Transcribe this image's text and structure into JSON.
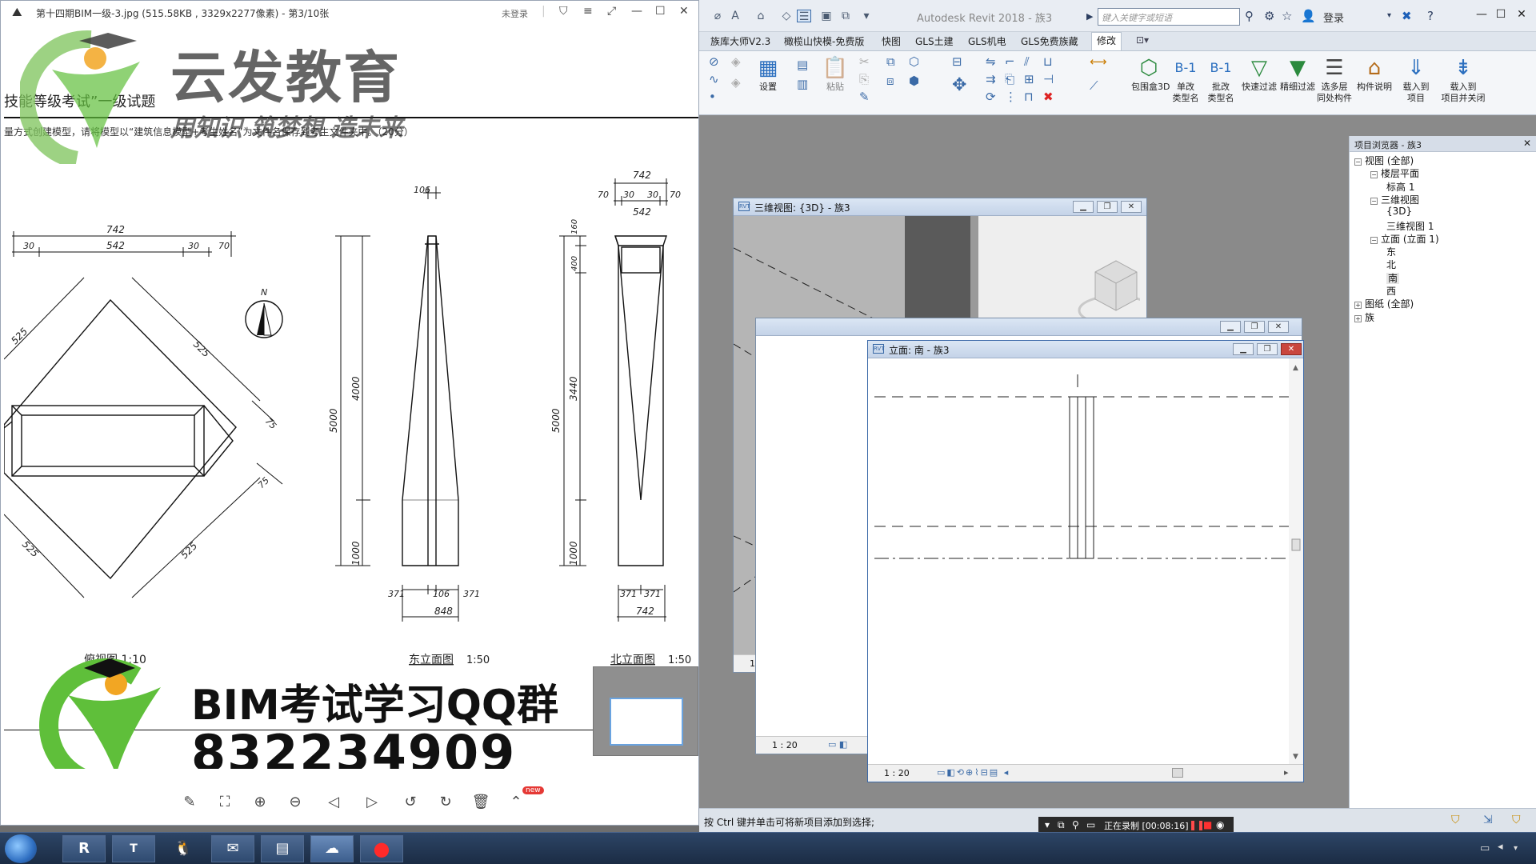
{
  "viewer": {
    "title": "第十四期BIM一级-3.jpg (515.58KB , 3329x2277像素) - 第3/10张",
    "login": "未登录"
  },
  "drawing": {
    "heading": "技能等级考试”一级试题",
    "instruction": "量方式创建模型，请将模型以“建筑信息模型+考生姓名”为文件名保存到考生文件夹中。（20分）",
    "compass_label": "N",
    "plan": {
      "dim_top": "742",
      "dim_left": "30",
      "dim_mid": "542",
      "dim_right1": "30",
      "dim_right2": "70",
      "edge_labels": [
        "525",
        "525",
        "525",
        "525"
      ],
      "offsets": [
        "75",
        "75"
      ],
      "caption": "俯视图  1:10"
    },
    "east": {
      "top_dim": "106",
      "total_height": "5000",
      "upper_height": "4000",
      "base_height": "1000",
      "bottom_dims": [
        "371",
        "106",
        "371"
      ],
      "bottom_total": "848",
      "caption": "东立面图",
      "scale": "1:50"
    },
    "north": {
      "top_total": "742",
      "top_parts": [
        "70",
        "30",
        "30",
        "70"
      ],
      "top_inner": "542",
      "top_heights": [
        "160",
        "400"
      ],
      "total_height": "5000",
      "mid_height": "3440",
      "base_height": "1000",
      "bottom_dims": [
        "371",
        "371"
      ],
      "bottom_total": "742",
      "caption": "北立面图",
      "scale": "1:50"
    }
  },
  "watermark": {
    "brand": "云发教育",
    "slogan": "用知识 筑梦想 造未来",
    "qq_label": "BIM考试学习QQ群",
    "qq_number": "832234909"
  },
  "viewer_toolbar": {
    "new_badge": "new"
  },
  "revit": {
    "title": "Autodesk Revit 2018 -   族3",
    "search_placeholder": "键入关键字或短语",
    "login": "登录",
    "tabs": [
      "族库大师V2.3",
      "橄榄山快模-免费版",
      "快图",
      "GLS土建",
      "GLS机电",
      "GLS免费族藏",
      "修改"
    ],
    "ribbon_buttons": [
      {
        "label": "设置"
      },
      {
        "label": "粘贴"
      },
      {
        "label": "包围盒3D"
      },
      {
        "label": "单改\n类型名"
      },
      {
        "label": "批改\n类型名"
      },
      {
        "label": "快速过滤"
      },
      {
        "label": "精细过滤"
      },
      {
        "label": "选多层\n同处构件"
      },
      {
        "label": "构件说明"
      },
      {
        "label": "载入到\n项目"
      },
      {
        "label": "载入到\n项目并关闭"
      }
    ],
    "status_text": "按 Ctrl 键并单击可将新项目添加到选择;",
    "recording": "正在录制 [00:08:16]"
  },
  "project_browser": {
    "title": "项目浏览器 - 族3",
    "items": [
      {
        "label": "视图 (全部)",
        "level": 0,
        "expanded": true
      },
      {
        "label": "楼层平面",
        "level": 1,
        "expanded": true
      },
      {
        "label": "标高 1",
        "level": 2
      },
      {
        "label": "三维视图",
        "level": 1,
        "expanded": true
      },
      {
        "label": "{3D}",
        "level": 2
      },
      {
        "label": "三维视图 1",
        "level": 2
      },
      {
        "label": "立面 (立面 1)",
        "level": 1,
        "expanded": true
      },
      {
        "label": "东",
        "level": 2
      },
      {
        "label": "北",
        "level": 2
      },
      {
        "label": "南",
        "level": 2,
        "selected": true
      },
      {
        "label": "西",
        "level": 2
      },
      {
        "label": "图纸 (全部)",
        "level": 0
      },
      {
        "label": "族",
        "level": 0
      }
    ]
  },
  "views": {
    "view3d_title": "三维视图: {3D} - 族3",
    "elev_title": "立面: 南 - 族3",
    "scale": "1 : 20"
  },
  "colors": {
    "revit_accent": "#2b6fbf",
    "watermark_green": "#5fbf3a",
    "watermark_text": "#2b2b2b",
    "close_red": "#c9463d"
  }
}
